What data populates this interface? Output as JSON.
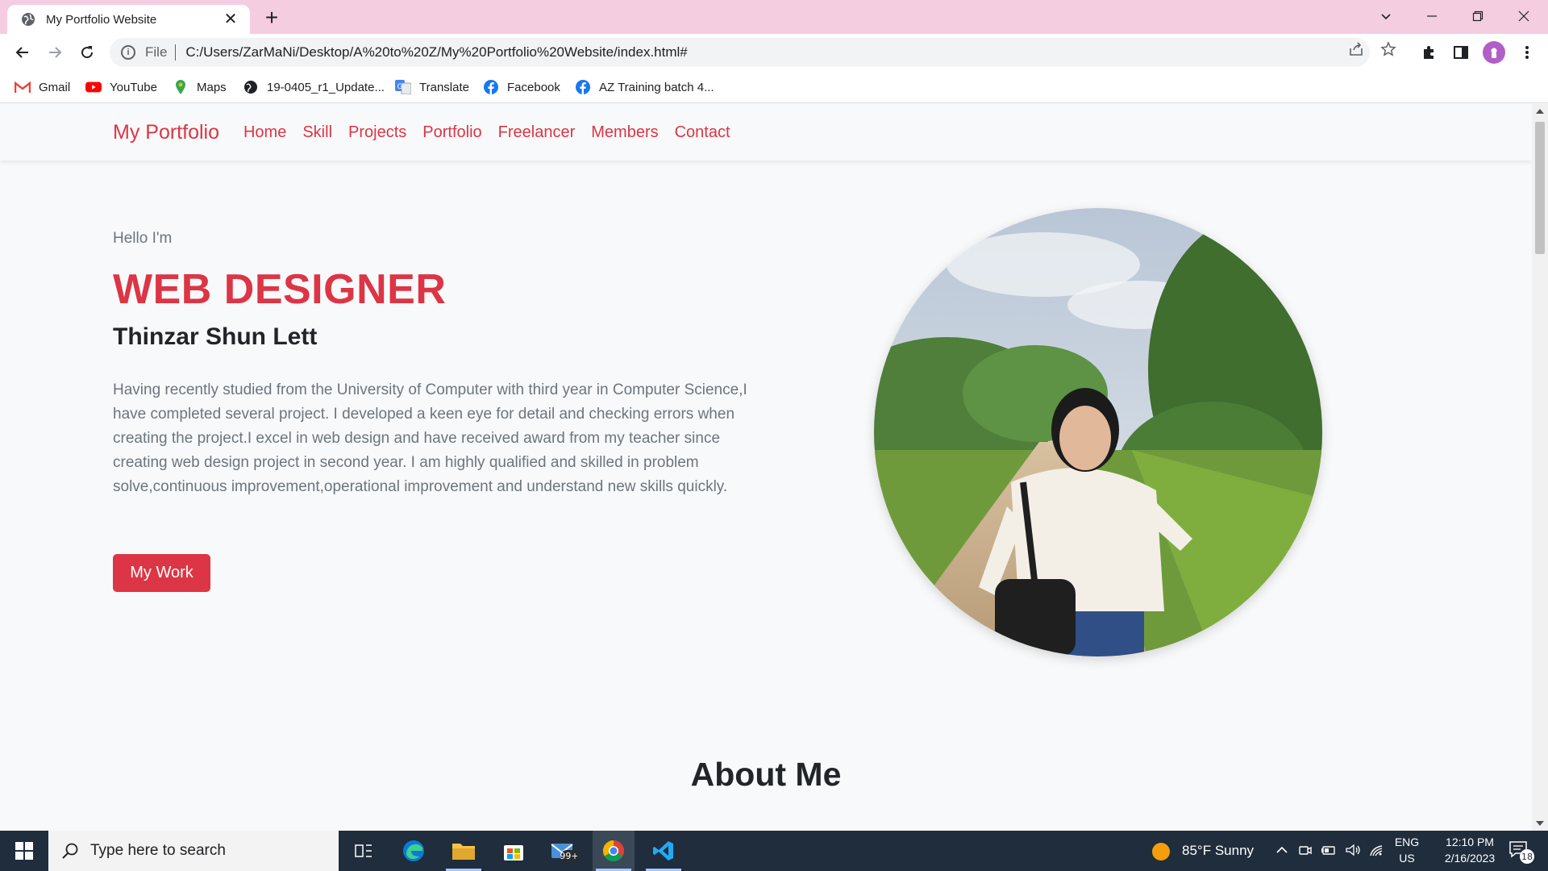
{
  "browser": {
    "tab_title": "My Portfolio Website",
    "tab_close": "✕",
    "new_tab": "+",
    "scheme": "File",
    "url": "C:/Users/ZarMaNi/Desktop/A%20to%20Z/My%20Portfolio%20Website/index.html#"
  },
  "bookmarks": [
    {
      "label": "Gmail",
      "icon": "gmail-icon"
    },
    {
      "label": "YouTube",
      "icon": "youtube-icon"
    },
    {
      "label": "Maps",
      "icon": "maps-icon"
    },
    {
      "label": "19-0405_r1_Update...",
      "icon": "globe-icon"
    },
    {
      "label": "Translate",
      "icon": "translate-icon"
    },
    {
      "label": "Facebook",
      "icon": "facebook-icon"
    },
    {
      "label": "AZ Training batch 4...",
      "icon": "facebook-icon"
    }
  ],
  "site": {
    "brand": "My Portfolio",
    "nav": [
      "Home",
      "Skill",
      "Projects",
      "Portfolio",
      "Freelancer",
      "Members",
      "Contact"
    ],
    "hero": {
      "greeting": "Hello I'm",
      "role": "WEB DESIGNER",
      "name": "Thinzar Shun Lett",
      "bio": "Having recently studied from the University of Computer with third year in Computer Science,I have completed several project. I developed a keen eye for detail and checking errors when creating the project.I excel in web design and have received award from my teacher since creating web design project in second year. I am highly qualified and skilled in problem solve,continuous improvement,operational improvement and understand new skills quickly.",
      "button": "My Work"
    },
    "about_title": "About Me"
  },
  "colors": {
    "accent": "#dc3545",
    "tabstrip": "#f4cde1",
    "taskbar": "#1f2d3d"
  },
  "taskbar": {
    "search_placeholder": "Type here to search",
    "mail_badge": "99+",
    "weather": "85°F  Sunny",
    "lang": "ENG",
    "region": "US",
    "time": "12:10 PM",
    "date": "2/16/2023",
    "notifications": "18"
  }
}
